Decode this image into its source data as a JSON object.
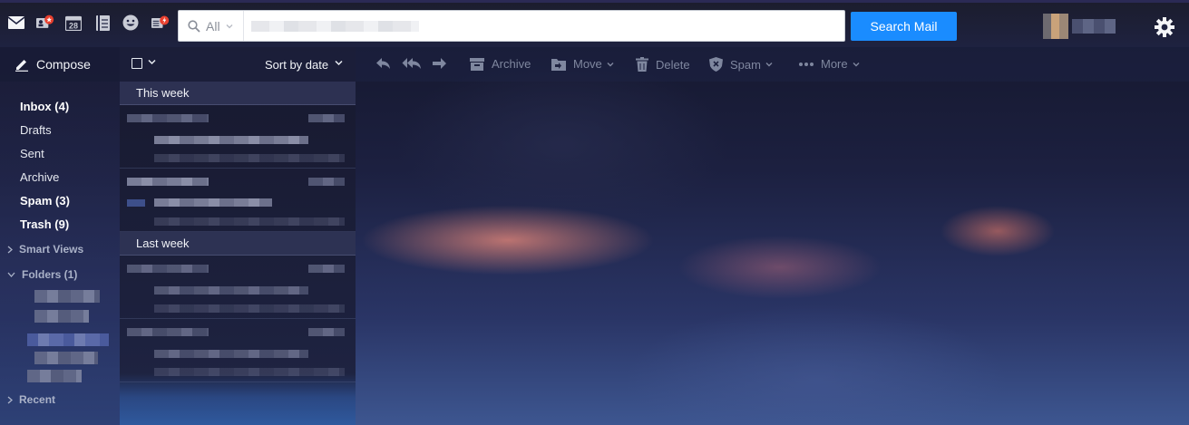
{
  "app_icons": [
    {
      "name": "mail-icon"
    },
    {
      "name": "contacts-icon"
    },
    {
      "name": "calendar-icon",
      "day": "28"
    },
    {
      "name": "notepad-icon"
    },
    {
      "name": "messenger-icon"
    },
    {
      "name": "newsfeed-icon"
    }
  ],
  "search": {
    "scope_label": "All",
    "placeholder": "",
    "button_label": "Search Mail"
  },
  "compose": {
    "label": "Compose"
  },
  "list_toolbar": {
    "sort_label": "Sort by date"
  },
  "message_toolbar": {
    "archive": "Archive",
    "move": "Move",
    "delete": "Delete",
    "spam": "Spam",
    "more": "More"
  },
  "sidebar": {
    "items": [
      {
        "label": "Inbox (4)",
        "bold": true
      },
      {
        "label": "Drafts",
        "bold": false
      },
      {
        "label": "Sent",
        "bold": false
      },
      {
        "label": "Archive",
        "bold": false
      },
      {
        "label": "Spam (3)",
        "bold": true
      },
      {
        "label": "Trash (9)",
        "bold": true
      }
    ],
    "sections": {
      "smart_views": "Smart Views",
      "folders": "Folders (1)",
      "recent": "Recent"
    }
  },
  "message_list": {
    "groups": [
      {
        "label": "This week"
      },
      {
        "label": "Last week"
      }
    ]
  },
  "colors": {
    "accent": "#1a8cff",
    "topbar": "#1e2240",
    "badge_red": "#e8402e"
  }
}
